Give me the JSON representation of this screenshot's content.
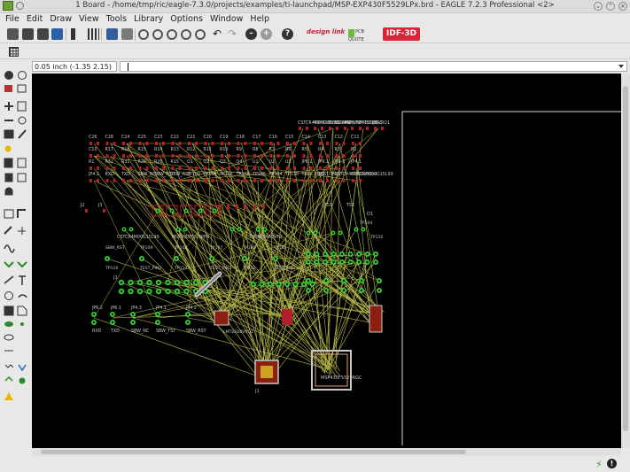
{
  "window": {
    "title": "1 Board - /home/tmp/ric/eagle-7.3.0/projects/examples/ti-launchpad/MSP-EXP430F5529LPx.brd - EAGLE 7.2.3 Professional <2>"
  },
  "menu": [
    "File",
    "Edit",
    "Draw",
    "View",
    "Tools",
    "Library",
    "Options",
    "Window",
    "Help"
  ],
  "toolbar": {
    "designlink_label": "design link",
    "fusion_label": "PCB QUOTE",
    "idf_label": "IDF-3D"
  },
  "command": {
    "coordinate": "0.05 inch (-1.35 2.15)",
    "input_value": ""
  },
  "board": {
    "components": [
      "C26",
      "C28",
      "C24",
      "C25",
      "C23",
      "C22",
      "C21",
      "C20",
      "C19",
      "C18",
      "C17",
      "C16",
      "C15",
      "C14",
      "C13",
      "C12",
      "C11",
      "C10",
      "R17",
      "R16",
      "R15",
      "R14",
      "R13",
      "R12",
      "R11",
      "R10",
      "R9",
      "R8",
      "R7",
      "R6",
      "R5",
      "R4",
      "R3",
      "R2",
      "R1",
      "R32",
      "R31",
      "R28",
      "R26",
      "R15",
      "Q1",
      "Q2",
      "Q3",
      "Q4",
      "U1",
      "U2",
      "U3",
      "JP6.2",
      "JP6.1",
      "JP4.3",
      "JP4.1",
      "JP4.2",
      "RXD",
      "TXD",
      "SBW_NC",
      "SBW_TST",
      "SBW_RST",
      "TP109",
      "TP108",
      "TP107",
      "TP106",
      "TP105",
      "TP104",
      "TP110",
      "TEST_PIN2",
      "TEST_PIN1",
      "CSTCR4M00G15L99",
      "CSTCR4M00G15L99",
      "CSTCR4M00G15L99",
      "MSP430F5529IPN",
      "TUSB2046BVFR",
      "MSP430F5529RGC",
      "LMT82DBVRQ1",
      "J1",
      "J2",
      "J3",
      "TS1",
      "TS2",
      "D1",
      "D2",
      "D3"
    ]
  },
  "colors": {
    "canvas": "#000000",
    "airwire": "#b9b94a",
    "silk": "#c8c8c8",
    "pad": "#2fcf2f",
    "top_copper": "#b02028",
    "accent": "#dd2335"
  }
}
